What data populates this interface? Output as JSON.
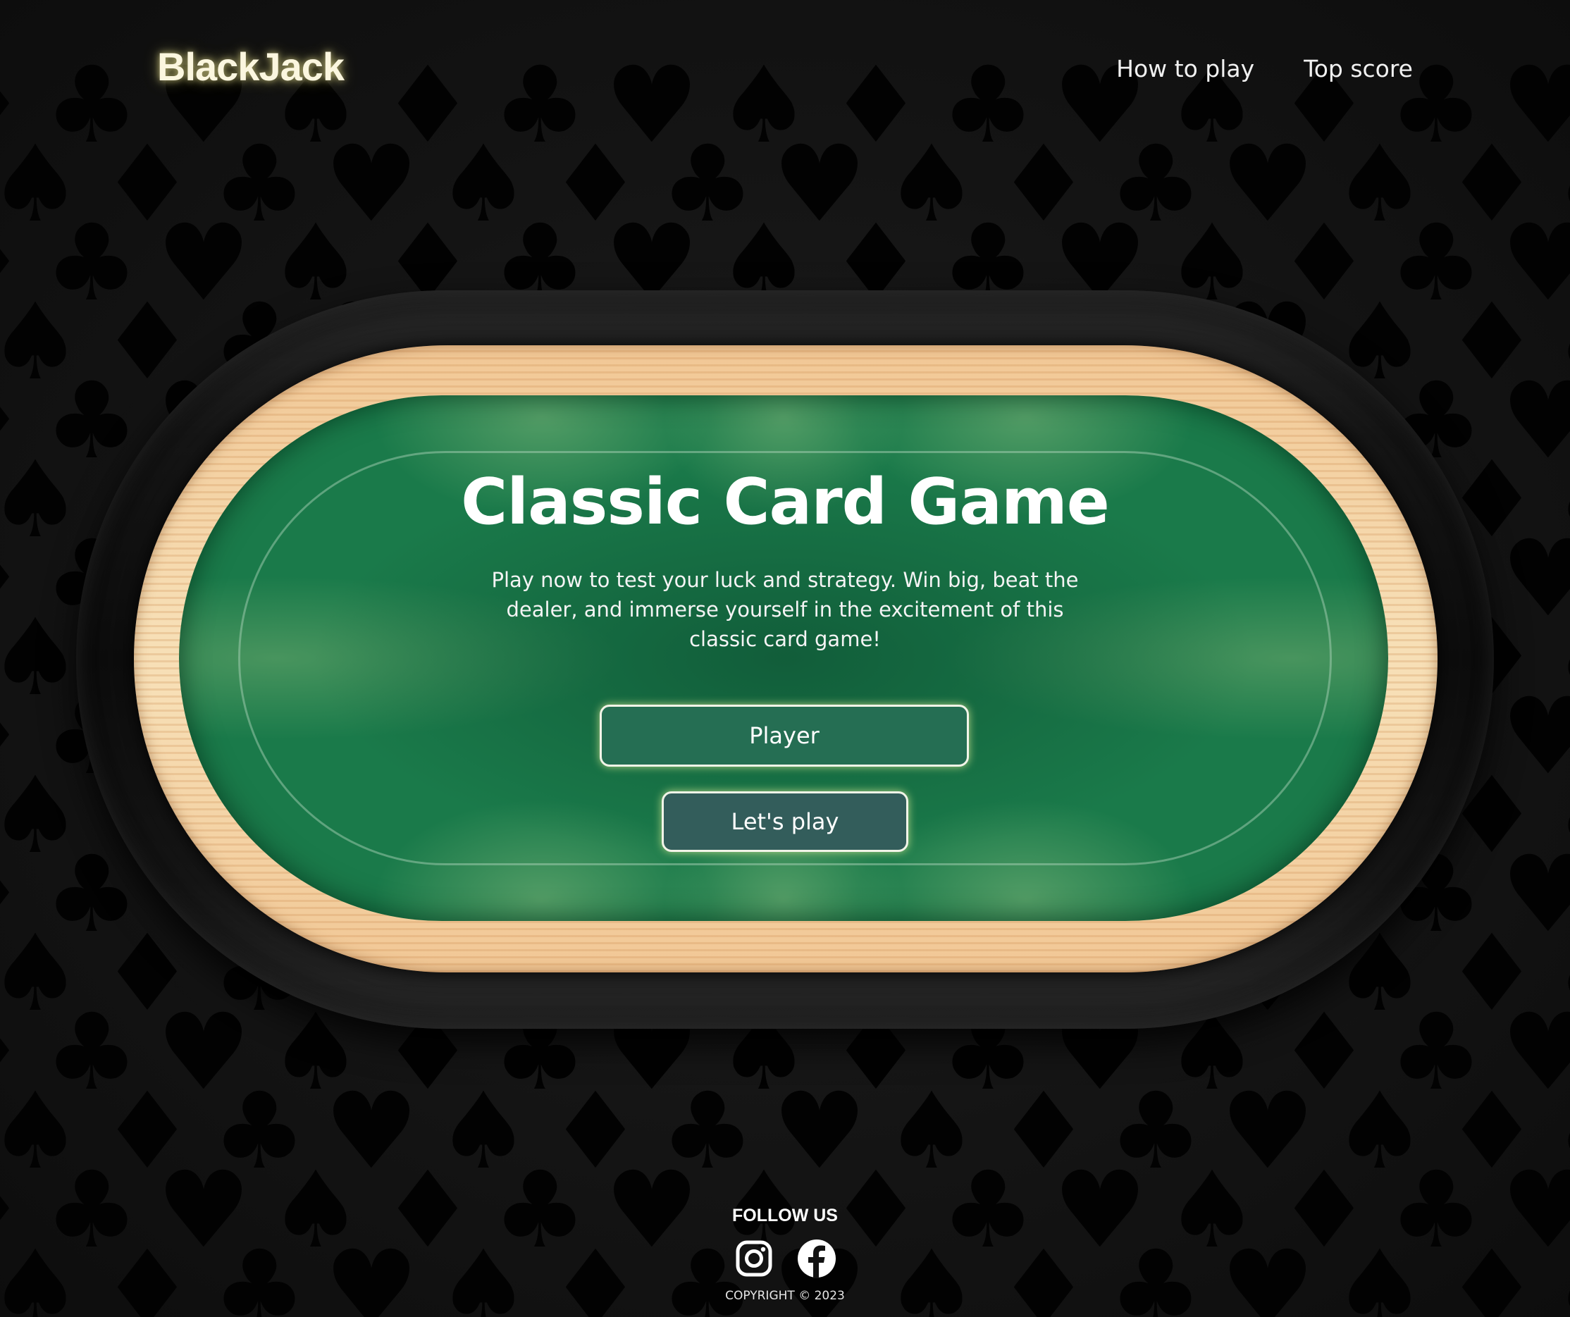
{
  "header": {
    "logo": "BlackJack",
    "nav": {
      "how_to_play": "How to play",
      "top_score": "Top score"
    }
  },
  "hero": {
    "title": "Classic Card Game",
    "description": "Play now to test your luck and strategy. Win big, beat the dealer, and immerse yourself in the excitement of this classic card game!",
    "player_button": "Player",
    "play_button": "Let's play"
  },
  "footer": {
    "follow_label": "FOLLOW US",
    "social": [
      "instagram-icon",
      "facebook-icon"
    ],
    "copyright": "COPYRIGHT © 2023"
  },
  "colors": {
    "background": "#121212",
    "felt": "#1a7a4a",
    "wood": "#f7dfb6",
    "rail": "#161616",
    "logo_glow": "#ece696",
    "player_button": "#256e53",
    "play_button": "#335d5b"
  }
}
